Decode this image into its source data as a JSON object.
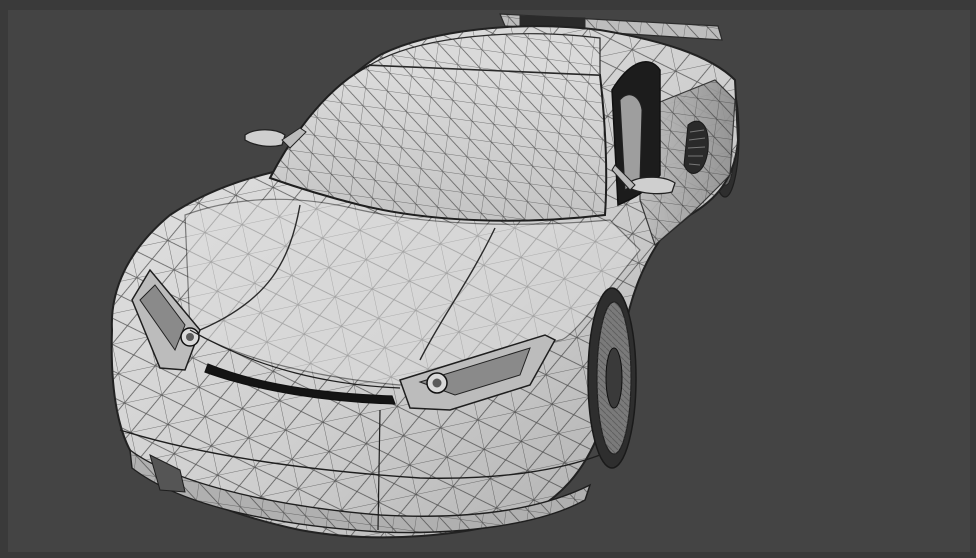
{
  "viewport": {
    "background_color": "#444444",
    "frame_color": "#3a3a3a",
    "shading_mode": "wireframe-on-shaded"
  },
  "model": {
    "body_color": "#d4d4d4",
    "highlight_color": "#ececec",
    "shadow_color": "#9a9a9a",
    "wire_color": "#2b2b2b",
    "glass_color": "#1c1c1c"
  }
}
